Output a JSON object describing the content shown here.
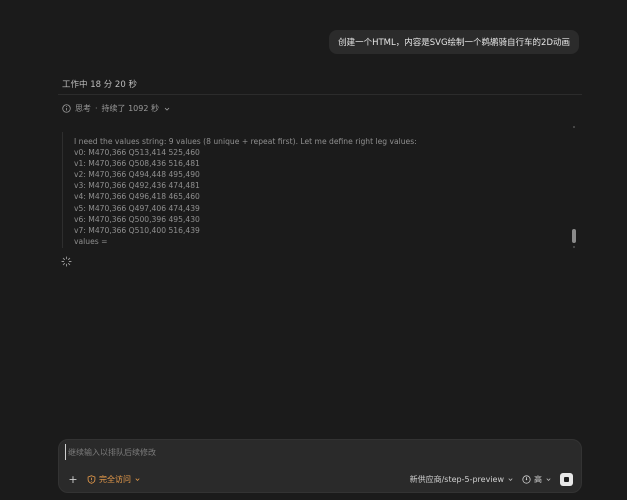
{
  "conversation": {
    "user_message": "创建一个HTML，内容是SVG绘制一个鹈鹕骑自行车的2D动画",
    "worked_status": "工作中 18 分 20 秒",
    "thinking": {
      "label": "思考",
      "separator": "·",
      "duration": "持续了 1092 秒",
      "content": "I need the values string: 9 values (8 unique + repeat first). Let me define right leg values:\nv0: M470,366 Q513,414 525,460\nv1: M470,366 Q508,436 516,481\nv2: M470,366 Q494,448 495,490\nv3: M470,366 Q492,436 474,481\nv4: M470,366 Q496,418 465,460\nv5: M470,366 Q497,406 474,439\nv6: M470,366 Q500,396 495,430\nv7: M470,366 Q510,400 516,439\nvalues ="
    }
  },
  "composer": {
    "placeholder": "继续输入以排队后续修改",
    "plus_label": "+",
    "access_label": "完全访问",
    "model_label": "新供应商/step-5-preview",
    "level_label": "高"
  },
  "icons": {
    "info": "info-circle-icon",
    "chevron": "chevron-down-icon",
    "spinner": "loading-spinner-icon",
    "shield": "shield-warning-icon",
    "stop": "stop-icon"
  },
  "colors": {
    "background": "#1b1b1b",
    "bubble": "#2b2b2b",
    "composer": "#2a2a2a",
    "access_accent": "#e69a4a"
  }
}
